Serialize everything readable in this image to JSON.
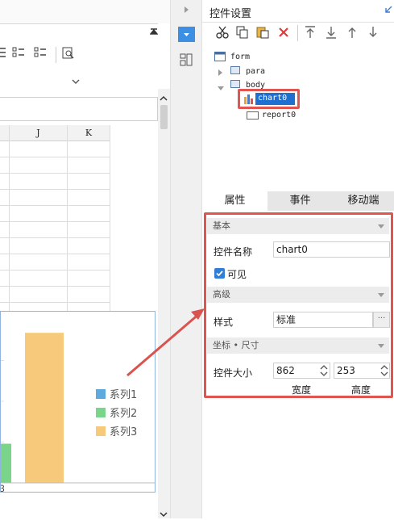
{
  "spreadsheet": {
    "columns": [
      "J",
      "K"
    ],
    "legend": [
      {
        "label": "系列1",
        "color": "#5ea9dd"
      },
      {
        "label": "系列2",
        "color": "#7ad58a"
      },
      {
        "label": "系列3",
        "color": "#f7c97a"
      }
    ],
    "x_tick": "3"
  },
  "chart_data": {
    "type": "bar",
    "categories": [
      "3"
    ],
    "series": [
      {
        "name": "系列1",
        "values": [
          null
        ]
      },
      {
        "name": "系列2",
        "values": [
          12
        ]
      },
      {
        "name": "系列3",
        "values": [
          46
        ]
      }
    ],
    "xlabel": "",
    "ylabel": "",
    "ylim": [
      0,
      50
    ],
    "legend": "right"
  },
  "panel": {
    "title": "控件设置",
    "tree": {
      "form": "form",
      "para": "para",
      "body": "body",
      "chart": "chart0",
      "report": "report0"
    },
    "tabs": [
      "属性",
      "事件",
      "移动端"
    ],
    "sections": {
      "basic": "基本",
      "advanced": "高级",
      "coord": "坐标 • 尺寸"
    },
    "name_label": "控件名称",
    "name_value": "chart0",
    "visible_label": "可见",
    "style_label": "样式",
    "style_value": "标准",
    "style_more": "···",
    "size_label": "控件大小",
    "width_value": "862",
    "height_value": "253",
    "width_caption": "宽度",
    "height_caption": "高度"
  },
  "colors": {
    "highlight": "#e05550",
    "selection": "#1f6fd1",
    "arrow": "#d9534f"
  }
}
